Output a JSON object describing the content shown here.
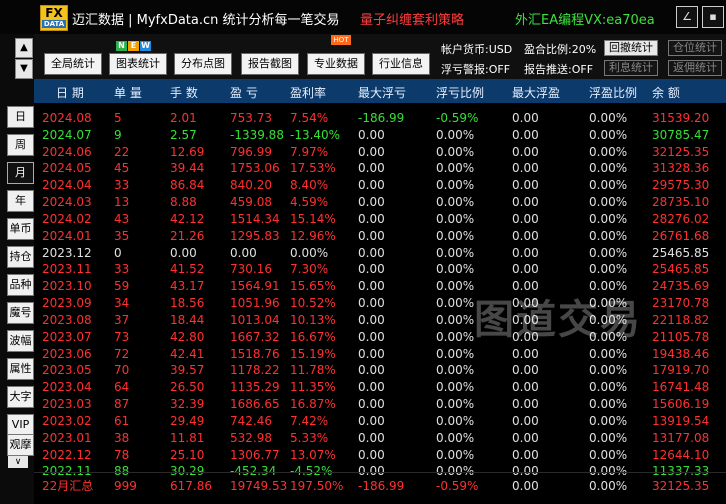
{
  "titlebar": {
    "logo_top": "FX",
    "logo_bottom": "DATA",
    "app_title": "迈汇数据 | MyfxData.cn  统计分析每一笔交易",
    "strategy": "量子纠缠套利策略",
    "contact": "外汇EA编程VX:ea70ea",
    "minimize_glyph": "∠",
    "maximize_glyph": "▪"
  },
  "nav": {
    "up": "▲",
    "down": "▼",
    "scroll_down": "∨"
  },
  "period_tabs": [
    "日",
    "周",
    "月",
    "年"
  ],
  "active_period": "月",
  "side_menu": [
    "单币",
    "持仓",
    "品种",
    "魔号",
    "波幅",
    "属性",
    "大字",
    "VIP",
    "观摩"
  ],
  "toolbar": {
    "buttons": [
      "全局统计",
      "图表统计",
      "分布点图",
      "报告截图",
      "专业数据",
      "行业信息"
    ],
    "new_badge": [
      "N",
      "E",
      "W"
    ],
    "hot_badge": "HOT"
  },
  "status": {
    "currency": "帐户货币:USD",
    "ratio": "盈合比例:20%",
    "float_alert": "浮亏警报:OFF",
    "report_push": "报告推送:OFF",
    "buttons": [
      "回撤统计",
      "仓位统计",
      "利息统计",
      "返佣统计"
    ]
  },
  "colors": {
    "profit": "#ff3030",
    "loss": "#35e035",
    "neutral": "#e0e0e0",
    "header_bg": "#0b3a6b"
  },
  "table": {
    "columns": [
      "日 期",
      "单 量",
      "手 数",
      "盈 亏",
      "盈利率",
      "最大浮亏",
      "浮亏比例",
      "最大浮盈",
      "浮盈比例",
      "余 额"
    ],
    "rows": [
      {
        "cells": [
          "2024.08",
          "5",
          "2.01",
          "753.73",
          "7.54%",
          "-186.99",
          "-0.59%",
          "0.00",
          "0.00%",
          "31539.20"
        ],
        "tone": "profit"
      },
      {
        "cells": [
          "2024.07",
          "9",
          "2.57",
          "-1339.88",
          "-13.40%",
          "0.00",
          "0.00%",
          "0.00",
          "0.00%",
          "30785.47"
        ],
        "tone": "loss"
      },
      {
        "cells": [
          "2024.06",
          "22",
          "12.69",
          "796.99",
          "7.97%",
          "0.00",
          "0.00%",
          "0.00",
          "0.00%",
          "32125.35"
        ],
        "tone": "profit"
      },
      {
        "cells": [
          "2024.05",
          "45",
          "39.44",
          "1753.06",
          "17.53%",
          "0.00",
          "0.00%",
          "0.00",
          "0.00%",
          "31328.36"
        ],
        "tone": "profit"
      },
      {
        "cells": [
          "2024.04",
          "33",
          "86.84",
          "840.20",
          "8.40%",
          "0.00",
          "0.00%",
          "0.00",
          "0.00%",
          "29575.30"
        ],
        "tone": "profit"
      },
      {
        "cells": [
          "2024.03",
          "13",
          "8.88",
          "459.08",
          "4.59%",
          "0.00",
          "0.00%",
          "0.00",
          "0.00%",
          "28735.10"
        ],
        "tone": "profit"
      },
      {
        "cells": [
          "2024.02",
          "43",
          "42.12",
          "1514.34",
          "15.14%",
          "0.00",
          "0.00%",
          "0.00",
          "0.00%",
          "28276.02"
        ],
        "tone": "profit"
      },
      {
        "cells": [
          "2024.01",
          "35",
          "21.26",
          "1295.83",
          "12.96%",
          "0.00",
          "0.00%",
          "0.00",
          "0.00%",
          "26761.68"
        ],
        "tone": "profit"
      },
      {
        "cells": [
          "2023.12",
          "0",
          "0.00",
          "0.00",
          "0.00%",
          "0.00",
          "0.00%",
          "0.00",
          "0.00%",
          "25465.85"
        ],
        "tone": "neutral"
      },
      {
        "cells": [
          "2023.11",
          "33",
          "41.52",
          "730.16",
          "7.30%",
          "0.00",
          "0.00%",
          "0.00",
          "0.00%",
          "25465.85"
        ],
        "tone": "profit"
      },
      {
        "cells": [
          "2023.10",
          "59",
          "43.17",
          "1564.91",
          "15.65%",
          "0.00",
          "0.00%",
          "0.00",
          "0.00%",
          "24735.69"
        ],
        "tone": "profit"
      },
      {
        "cells": [
          "2023.09",
          "34",
          "18.56",
          "1051.96",
          "10.52%",
          "0.00",
          "0.00%",
          "0.00",
          "0.00%",
          "23170.78"
        ],
        "tone": "profit"
      },
      {
        "cells": [
          "2023.08",
          "37",
          "18.44",
          "1013.04",
          "10.13%",
          "0.00",
          "0.00%",
          "0.00",
          "0.00%",
          "22118.82"
        ],
        "tone": "profit"
      },
      {
        "cells": [
          "2023.07",
          "73",
          "42.80",
          "1667.32",
          "16.67%",
          "0.00",
          "0.00%",
          "0.00",
          "0.00%",
          "21105.78"
        ],
        "tone": "profit"
      },
      {
        "cells": [
          "2023.06",
          "72",
          "42.41",
          "1518.76",
          "15.19%",
          "0.00",
          "0.00%",
          "0.00",
          "0.00%",
          "19438.46"
        ],
        "tone": "profit"
      },
      {
        "cells": [
          "2023.05",
          "70",
          "39.57",
          "1178.22",
          "11.78%",
          "0.00",
          "0.00%",
          "0.00",
          "0.00%",
          "17919.70"
        ],
        "tone": "profit"
      },
      {
        "cells": [
          "2023.04",
          "64",
          "26.50",
          "1135.29",
          "11.35%",
          "0.00",
          "0.00%",
          "0.00",
          "0.00%",
          "16741.48"
        ],
        "tone": "profit"
      },
      {
        "cells": [
          "2023.03",
          "87",
          "32.39",
          "1686.65",
          "16.87%",
          "0.00",
          "0.00%",
          "0.00",
          "0.00%",
          "15606.19"
        ],
        "tone": "profit"
      },
      {
        "cells": [
          "2023.02",
          "61",
          "29.49",
          "742.46",
          "7.42%",
          "0.00",
          "0.00%",
          "0.00",
          "0.00%",
          "13919.54"
        ],
        "tone": "profit"
      },
      {
        "cells": [
          "2023.01",
          "38",
          "11.81",
          "532.98",
          "5.33%",
          "0.00",
          "0.00%",
          "0.00",
          "0.00%",
          "13177.08"
        ],
        "tone": "profit"
      },
      {
        "cells": [
          "2022.12",
          "78",
          "25.10",
          "1306.77",
          "13.07%",
          "0.00",
          "0.00%",
          "0.00",
          "0.00%",
          "12644.10"
        ],
        "tone": "profit"
      },
      {
        "cells": [
          "2022.11",
          "88",
          "30.29",
          "-452.34",
          "-4.52%",
          "0.00",
          "0.00%",
          "0.00",
          "0.00%",
          "11337.33"
        ],
        "tone": "loss"
      }
    ],
    "summary": [
      "22月汇总",
      "999",
      "617.86",
      "19749.53",
      "197.50%",
      "-186.99",
      "-0.59%",
      "0.00",
      "0.00%",
      "32125.35"
    ]
  },
  "watermark": "图道交易"
}
